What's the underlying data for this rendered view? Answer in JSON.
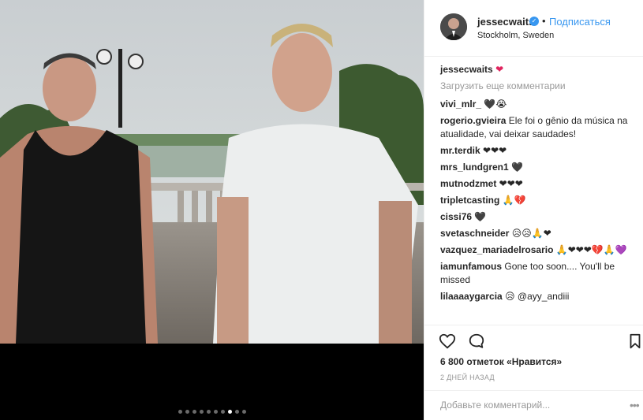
{
  "post": {
    "username": "jessecwaits",
    "follow_label": "Подписаться",
    "separator": "•",
    "location": "Stockholm, Sweden",
    "caption": "❤"
  },
  "comments_section": {
    "load_more": "Загрузить еще комментарии",
    "items": [
      {
        "user": "vivi_mlr_",
        "text": "🖤😭"
      },
      {
        "user": "rogerio.gvieira",
        "text": "Ele foi o gênio da música na atualidade, vai deixar saudades!"
      },
      {
        "user": "mr.terdik",
        "text": "❤❤❤"
      },
      {
        "user": "mrs_lundgren1",
        "text": "🖤"
      },
      {
        "user": "mutnodzmet",
        "text": "❤❤❤"
      },
      {
        "user": "tripletcasting",
        "text": "🙏💔"
      },
      {
        "user": "cissi76",
        "text": "🖤"
      },
      {
        "user": "svetaschneider",
        "text": "😥😥🙏❤"
      },
      {
        "user": "vazquez_mariadelrosario",
        "text": "🙏❤❤❤💔🙏💜"
      },
      {
        "user": "iamunfamous",
        "text": "Gone too soon.... You'll be missed"
      },
      {
        "user": "lilaaaaygarcia",
        "text": "😥 @ayy_andiii"
      }
    ]
  },
  "stats": {
    "likes": "6 800 отметок «Нравится»",
    "time": "2 ДНЕЙ НАЗАД"
  },
  "add_comment": {
    "placeholder": "Добавьте комментарий...",
    "more": "•••"
  },
  "carousel": {
    "count": 10,
    "active_index": 7
  },
  "icons": {
    "like": "heart-outline-icon",
    "comment": "speech-bubble-icon",
    "save": "bookmark-icon",
    "verified": "verified-badge-icon"
  },
  "colors": {
    "accent": "#3897f0",
    "heart": "#e0245e",
    "muted": "#999999",
    "text": "#262626"
  }
}
